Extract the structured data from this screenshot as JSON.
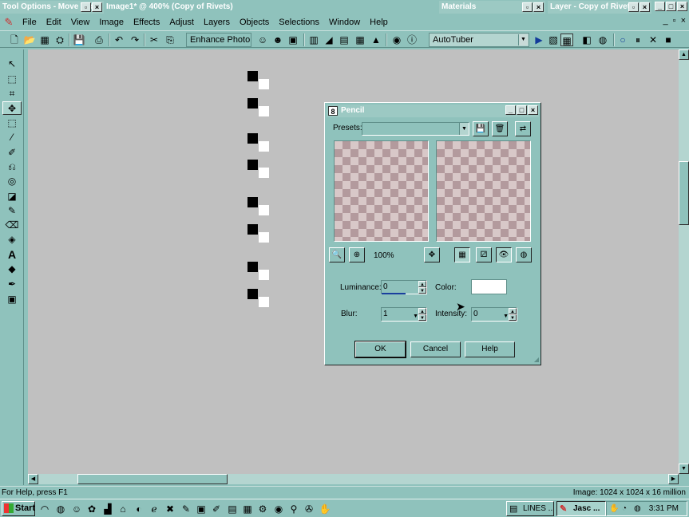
{
  "window_titles": {
    "tool_options": "Tool Options - Move Tool",
    "document": "Image1* @ 400% (Copy of Rivets)",
    "materials": "Materials",
    "layer": "Layer - Copy of Rivets"
  },
  "menubar": {
    "items": [
      "File",
      "Edit",
      "View",
      "Image",
      "Effects",
      "Adjust",
      "Layers",
      "Objects",
      "Selections",
      "Window",
      "Help"
    ]
  },
  "toolbar": {
    "enhance_photo_label": "Enhance Photo",
    "script_combo_value": "AutoTuber"
  },
  "dialog": {
    "title": "Pencil",
    "presets_label": "Presets:",
    "presets_value": "",
    "zoom_label": "100%",
    "luminance_label": "Luminance:",
    "luminance_value": "0",
    "color_label": "Color:",
    "color_value": "#ffffff",
    "blur_label": "Blur:",
    "blur_value": "1",
    "intensity_label": "Intensity:",
    "intensity_value": "0",
    "ok_label": "OK",
    "cancel_label": "Cancel",
    "help_label": "Help"
  },
  "statusbar": {
    "left_text": "For Help, press F1",
    "right_text": "Image:  1024 x 1024 x 16 million"
  },
  "taskbar": {
    "start_label": "Start",
    "buttons": [
      {
        "label": "LINES ..."
      },
      {
        "label": "Jasc ..."
      }
    ],
    "clock": "3:31 PM"
  },
  "colors": {
    "chrome": "#8fc2bc",
    "canvas": "#c0c0c0",
    "checker_dark": "#b39a9d",
    "checker_light": "#d8c8c8"
  }
}
